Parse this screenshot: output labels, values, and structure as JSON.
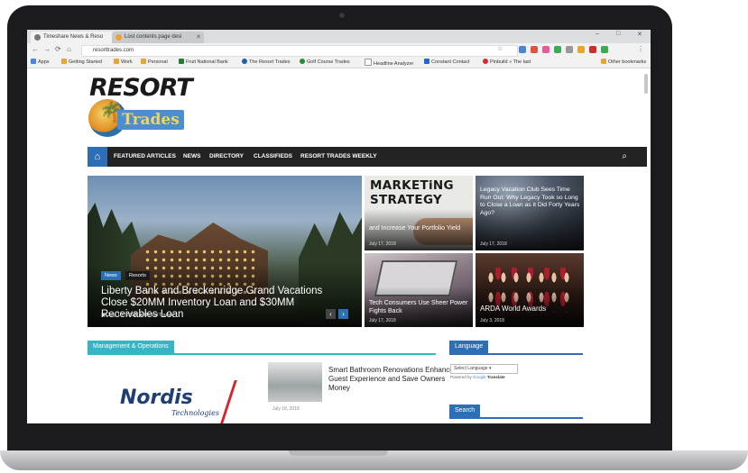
{
  "browser": {
    "tabs": [
      {
        "label": "Timeshare News & Reso",
        "active": true
      },
      {
        "label": "Lost contents page desi",
        "active": false
      }
    ],
    "address": "resorttrades.com",
    "bookmarks": [
      "Apps",
      "Getting Started",
      "Work",
      "Personal",
      "Fruit National Bank",
      "The Resort Trades",
      "Golf Course Trades",
      "Headline Analyzer",
      "Constant Contact",
      "Pinbuild » The last",
      "Other bookmarks"
    ]
  },
  "site": {
    "logo_top": "RESORT",
    "logo_bottom": "Trades",
    "nav": [
      "FEATURED ARTICLES",
      "NEWS",
      "DIRECTORY",
      "CLASSIFIEDS",
      "RESORT TRADES WEEKLY"
    ],
    "hero": {
      "badges": [
        "News",
        "Resorts"
      ],
      "title": "Liberty Bank and Breckenridge Grand Vacations Close $20MM Inventory Loan and $30MM Receivables Loan",
      "date": "July 18, 2018",
      "author": "ResortTrades"
    },
    "tiles": [
      {
        "image_text": "MARKETiNG STRATEGY",
        "title": "and Increase Your Portfolio Yield",
        "date": "July 17, 2018"
      },
      {
        "title": "Legacy Vacation Club Sees Time Run Out: Why Legacy Took so Long to Close a Loan as it Did Forty Years Ago?",
        "date": "July 17, 2018"
      },
      {
        "title": "Tech Consumers Use Sheer Power Fights Back",
        "date": "July 17, 2018"
      },
      {
        "title": "ARDA World Awards",
        "date": "July 3, 2018"
      }
    ],
    "section_title": "Management & Operations",
    "sponsor": {
      "name": "Nordis",
      "tagline": "Technologies"
    },
    "article": {
      "title": "Smart Bathroom Renovations Enhance Guest Experience and Save Owners Money",
      "date": "July 18, 2018"
    },
    "sidebar": {
      "language_heading": "Language",
      "select_placeholder": "Select Language",
      "powered_by": "Powered by",
      "powered_brand": "Google",
      "translate": "Translate",
      "search_heading": "Search"
    }
  },
  "colors": {
    "nav_bg": "#232323",
    "accent_blue": "#2d6fb6",
    "section_teal": "#35b5c5"
  }
}
